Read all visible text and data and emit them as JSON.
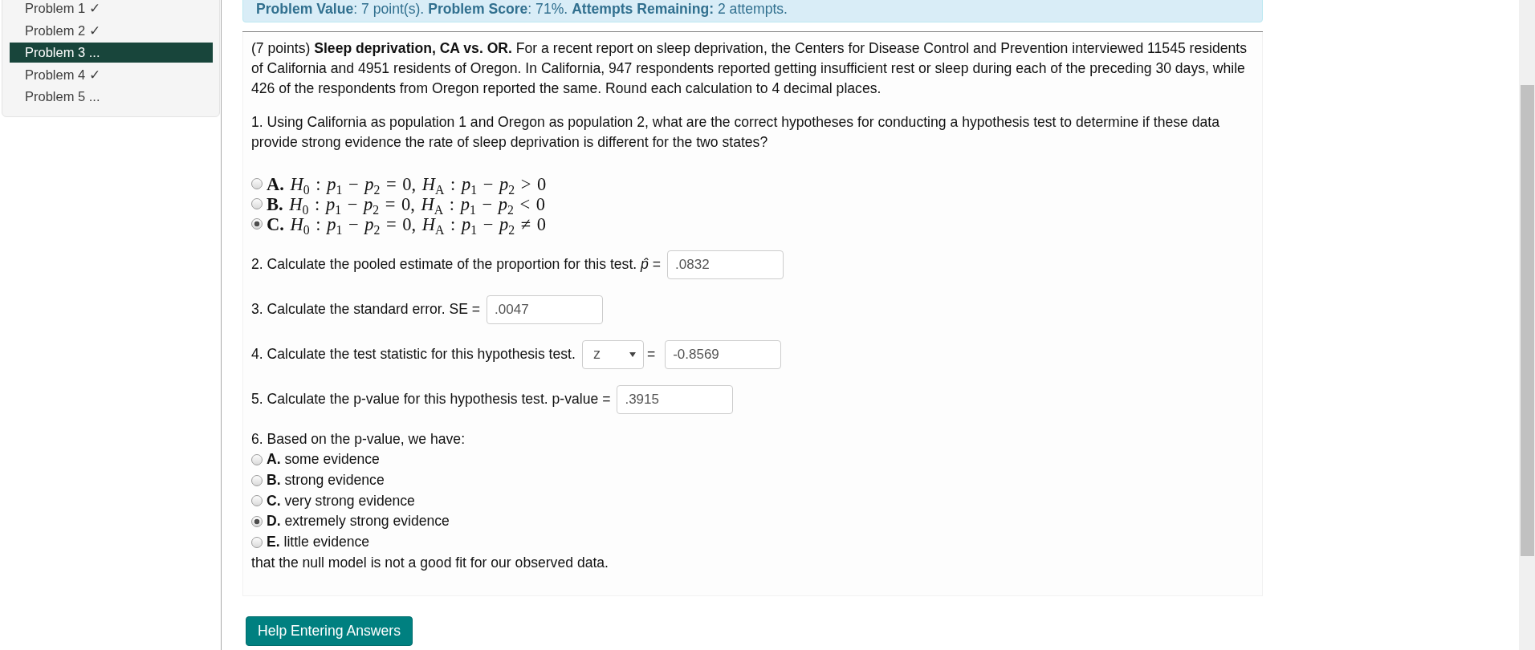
{
  "sidebar": {
    "items": [
      {
        "label": "Problem 1 ✓",
        "selected": false
      },
      {
        "label": "Problem 2 ✓",
        "selected": false
      },
      {
        "label": "Problem 3 ...",
        "selected": true
      },
      {
        "label": "Problem 4 ✓",
        "selected": false
      },
      {
        "label": "Problem 5 ...",
        "selected": false
      }
    ]
  },
  "status_banner": {
    "text": "**Problem Value**: 7 point(s). **Problem Score**: 71%. **Attempts Remaining:** 2 attempts."
  },
  "problem": {
    "statement": "(7 points) **Sleep deprivation, CA vs. OR.** For a recent report on sleep deprivation, the Centers for Disease Control and Prevention interviewed 11545 residents of California and 4951 residents of Oregon. In California, 947 respondents reported getting insufficient rest or sleep during each of the preceding 30 days, while 426 of the respondents from Oregon reported the same. Round each calculation to 4 decimal places.",
    "parts": [
      {
        "kind": "math_choice",
        "prompt": "1. Using California as population 1 and Oregon as population 2, what are the correct hypotheses for conducting a hypothesis test to determine if these data provide strong evidence the rate of sleep deprivation is different for the two states?",
        "options": [
          {
            "label": "**A.** *H*$_{0}$ : *p*$_{1}$ − *p*$_{2}$ = 0, *H*$_{A}$ : *p*$_{1}$ − *p*$_{2}$ > 0",
            "selected": false
          },
          {
            "label": "**B.** *H*$_{0}$ : *p*$_{1}$ − *p*$_{2}$ = 0, *H*$_{A}$ : *p*$_{1}$ − *p*$_{2}$ < 0",
            "selected": false
          },
          {
            "label": "**C.** *H*$_{0}$ : *p*$_{1}$ − *p*$_{2}$ = 0, *H*$_{A}$ : *p*$_{1}$ − *p*$_{2}$ ≠ 0",
            "selected": true
          }
        ]
      },
      {
        "kind": "input",
        "prompt": "2. Calculate the pooled estimate of the proportion for this test. *p̂* =",
        "value": ".0832"
      },
      {
        "kind": "input",
        "prompt": "3. Calculate the standard error. SE =",
        "value": ".0047"
      },
      {
        "kind": "select_input",
        "prompt": "4. Calculate the test statistic for this hypothesis test.",
        "select_value": "z",
        "equals": "=",
        "value": "-0.8569"
      },
      {
        "kind": "input",
        "prompt": "5. Calculate the p-value for this hypothesis test. p-value =",
        "value": ".3915"
      },
      {
        "kind": "choice",
        "prompt": "6. Based on the p-value, we have:",
        "options": [
          {
            "label": "**A.** some evidence",
            "selected": false
          },
          {
            "label": "**B.** strong evidence",
            "selected": false
          },
          {
            "label": "**C.** very strong evidence",
            "selected": false
          },
          {
            "label": "**D.** extremely strong evidence",
            "selected": true
          },
          {
            "label": "**E.** little evidence",
            "selected": false
          }
        ],
        "after": "that the null model is not a good fit for our observed data."
      }
    ]
  },
  "help_button": {
    "label": "Help Entering Answers"
  }
}
